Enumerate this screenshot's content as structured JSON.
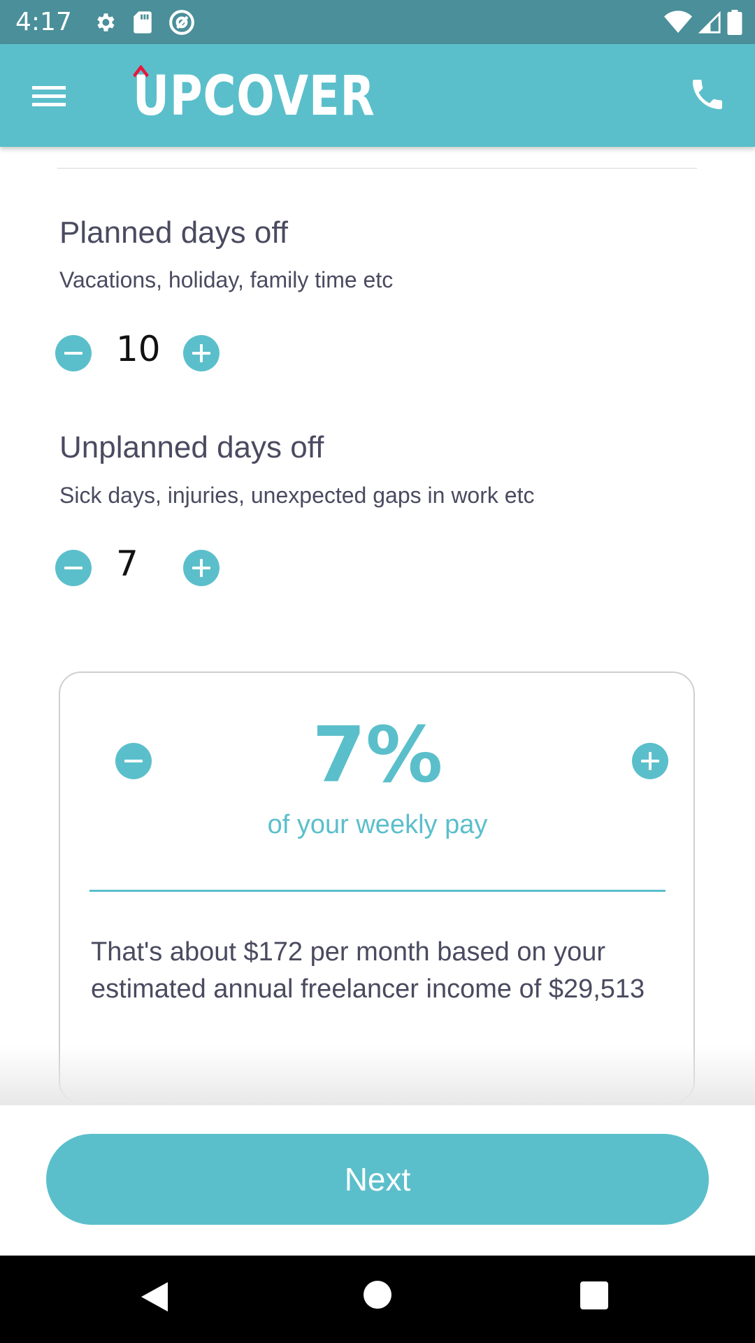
{
  "status_bar": {
    "time": "4:17",
    "icons_left": [
      "gear-icon",
      "sd-card-icon",
      "at-sign-icon"
    ],
    "icons_right": [
      "wifi-icon",
      "signal-icon",
      "battery-icon"
    ]
  },
  "app_bar": {
    "logo": "UPCOVER",
    "menu_icon": "hamburger-icon",
    "phone_icon": "phone-icon",
    "brand_color": "#5bbfcb",
    "logo_accent_color": "#e8173c"
  },
  "planned": {
    "title": "Planned days off",
    "subtitle": "Vacations, holiday, family time etc",
    "value": "10"
  },
  "unplanned": {
    "title": "Unplanned days off",
    "subtitle": "Sick days, injuries, unexpected gaps in work etc",
    "value": "7"
  },
  "card": {
    "percent": "7%",
    "caption": "of your weekly pay",
    "description": "That's about $172 per month based on your estimated annual freelancer income of $29,513"
  },
  "actions": {
    "next_label": "Next"
  }
}
